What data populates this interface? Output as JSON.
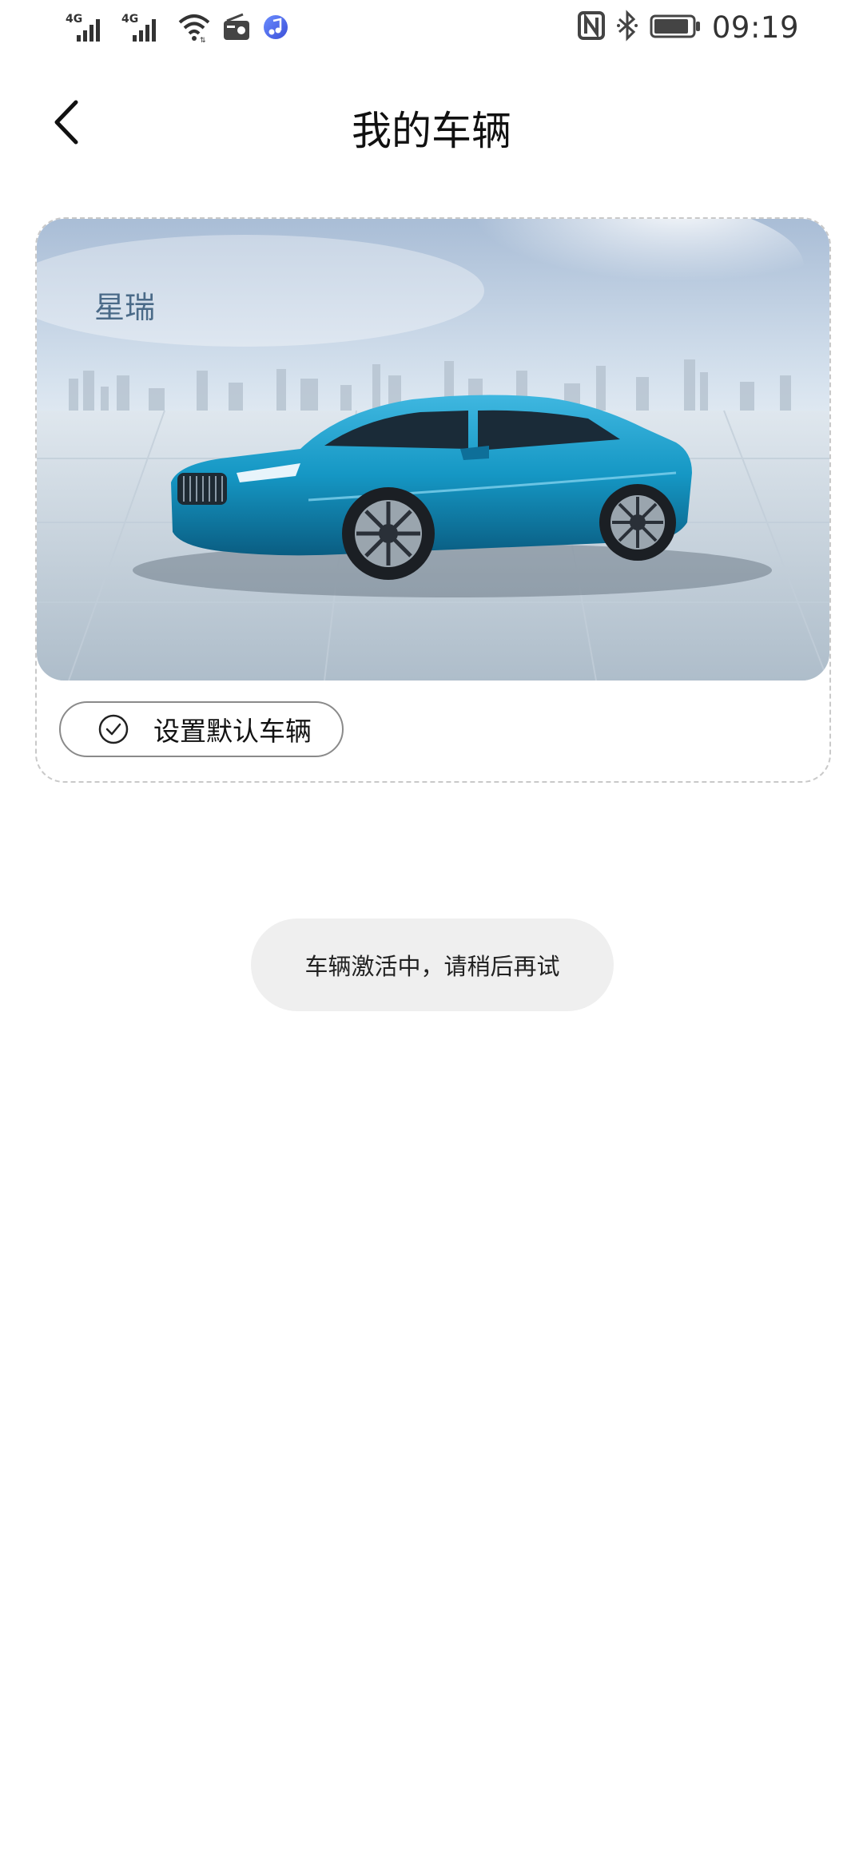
{
  "status_bar": {
    "left_icons": [
      "signal-4g-icon",
      "signal-4g-icon",
      "wifi-icon",
      "radio-icon",
      "music-app-icon"
    ],
    "signal_label_1": "4G",
    "signal_label_2": "4G",
    "right_icons": [
      "nfc-icon",
      "bluetooth-icon",
      "battery-icon"
    ],
    "time": "09:19"
  },
  "header": {
    "back_icon": "chevron-left-icon",
    "title": "我的车辆"
  },
  "vehicle_card": {
    "name": "星瑞",
    "image": "vehicle-photo",
    "default_button_icon": "check-circle-icon",
    "default_button_label": "设置默认车辆"
  },
  "toast": {
    "message": "车辆激活中，请稍后再试"
  },
  "colors": {
    "background": "#ffffff",
    "title_text": "#111111",
    "vehicle_name": "#4a6a88",
    "card_border": "#c9c9c9",
    "toast_bg": "#efefef",
    "car_body": "#1597c4"
  }
}
